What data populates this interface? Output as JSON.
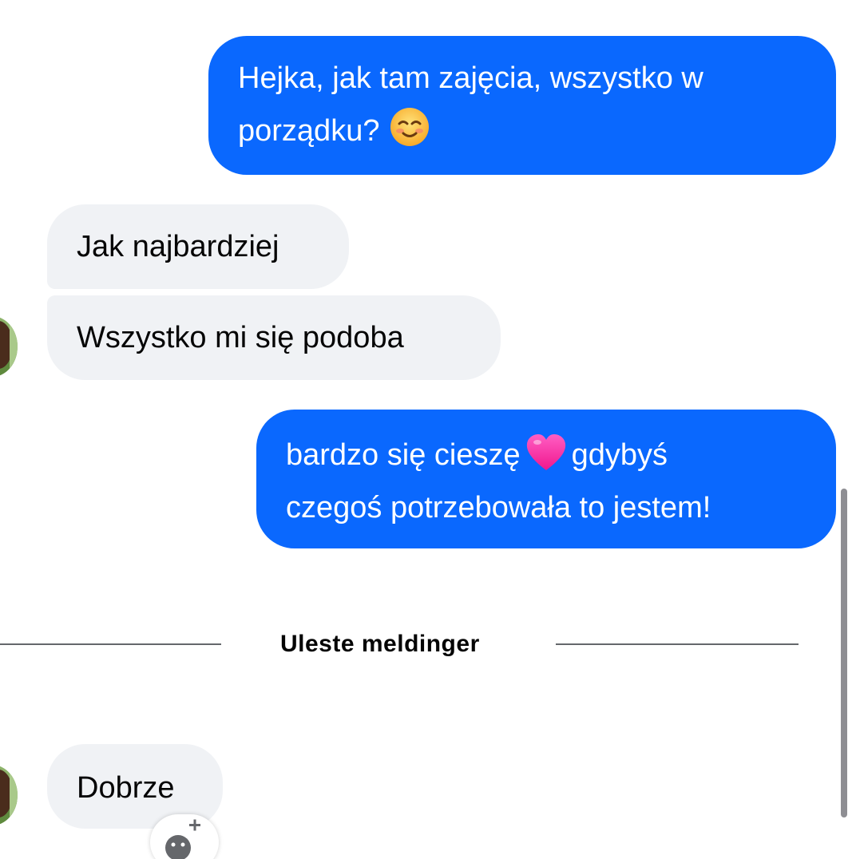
{
  "messages": [
    {
      "direction": "outgoing",
      "line1": "Hejka, jak tam zajęcia, wszystko w",
      "line2": "porządku?",
      "emoji": "smiling-face-icon"
    },
    {
      "direction": "incoming",
      "text": "Jak najbardziej"
    },
    {
      "direction": "incoming",
      "text": "Wszystko mi się podoba"
    },
    {
      "direction": "outgoing",
      "line1_before": "bardzo się cieszę",
      "emoji": "pink-heart-icon",
      "line1_after": "gdybyś",
      "line2": "czegoś potrzebowała to jestem!"
    },
    {
      "direction": "incoming",
      "text": "Dobrze"
    }
  ],
  "divider": {
    "label": "Uleste meldinger"
  },
  "colors": {
    "outgoing_bubble": "#0a68fe",
    "incoming_bubble": "#f0f2f5",
    "divider_line": "#65676b"
  }
}
